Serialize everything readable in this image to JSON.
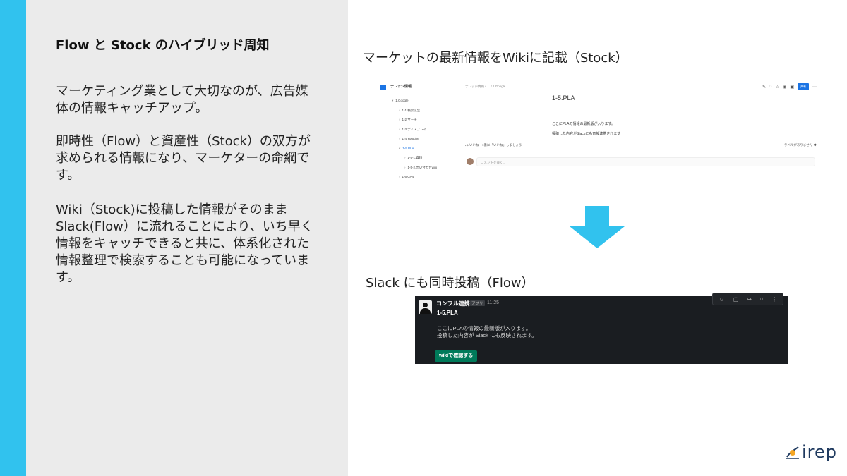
{
  "left_panel": {
    "title": "Flow と Stock のハイブリッド周知",
    "paragraphs": [
      "マーケティング業として大切なのが、広告媒体の情報キャッチアップ。",
      "即時性（Flow）と資産性（Stock）の双方が求められる情報になり、マーケターの命綱です。",
      "Wiki（Stock)に投稿した情報がそのままSlack(Flow）に流れることにより、いち早く情報をキャッチできると共に、体系化された情報整理で検索することも可能になっています。"
    ]
  },
  "stock_heading": "マーケットの最新情報をWikiに記載（Stock）",
  "flow_heading": "Slack にも同時投稿（Flow）",
  "wiki": {
    "space_name": "ナレッジ情報",
    "tree": [
      {
        "label": "1.Google",
        "level": 1,
        "caret": "▾"
      },
      {
        "label": "1-1.検索広告",
        "level": 2,
        "caret": "›"
      },
      {
        "label": "1-2.サーチ",
        "level": 2,
        "caret": "›"
      },
      {
        "label": "1-3.ディスプレイ",
        "level": 2,
        "caret": "›"
      },
      {
        "label": "1-4.Youtube",
        "level": 2,
        "caret": "›"
      },
      {
        "label": "1-5.PLA",
        "level": 2,
        "caret": "▾"
      },
      {
        "label": "1-5-1.資料",
        "level": 3,
        "caret": "›"
      },
      {
        "label": "1-5-2.問い合わせwiki",
        "level": 3,
        "caret": "›"
      },
      {
        "label": "1-6.GA4",
        "level": 2,
        "caret": "›"
      }
    ],
    "breadcrumb": "ナレッジ情報 / … / 1.Google",
    "page_title": "1-5.PLA",
    "body_lines": [
      "ここにPLAの情報の最新版が入ります。",
      "投稿した内容がSlackにも直接連携されます"
    ],
    "like_text": "いいね　1番に「いいね」しましょう",
    "labels_text": "ラベルがありません",
    "comment_placeholder": "コメントを書く...",
    "share_label": "共有"
  },
  "slack": {
    "sender": "コンフル連携",
    "app_tag": "アプリ",
    "time": "11:25",
    "title": "1-5.PLA",
    "lines": [
      "ここにPLAの情報の最新版が入ります。",
      "投稿した内容が Slack にも反映されます。"
    ],
    "button_label": "wikiで確認する"
  },
  "logo_text": "irep",
  "colors": {
    "accent": "#31c2ee",
    "panel_bg": "#ebebeb",
    "slack_bg": "#1a1d21",
    "slack_button": "#007a5a",
    "arrow": "#31c2ee",
    "confluence_blue": "#1b74e4"
  }
}
